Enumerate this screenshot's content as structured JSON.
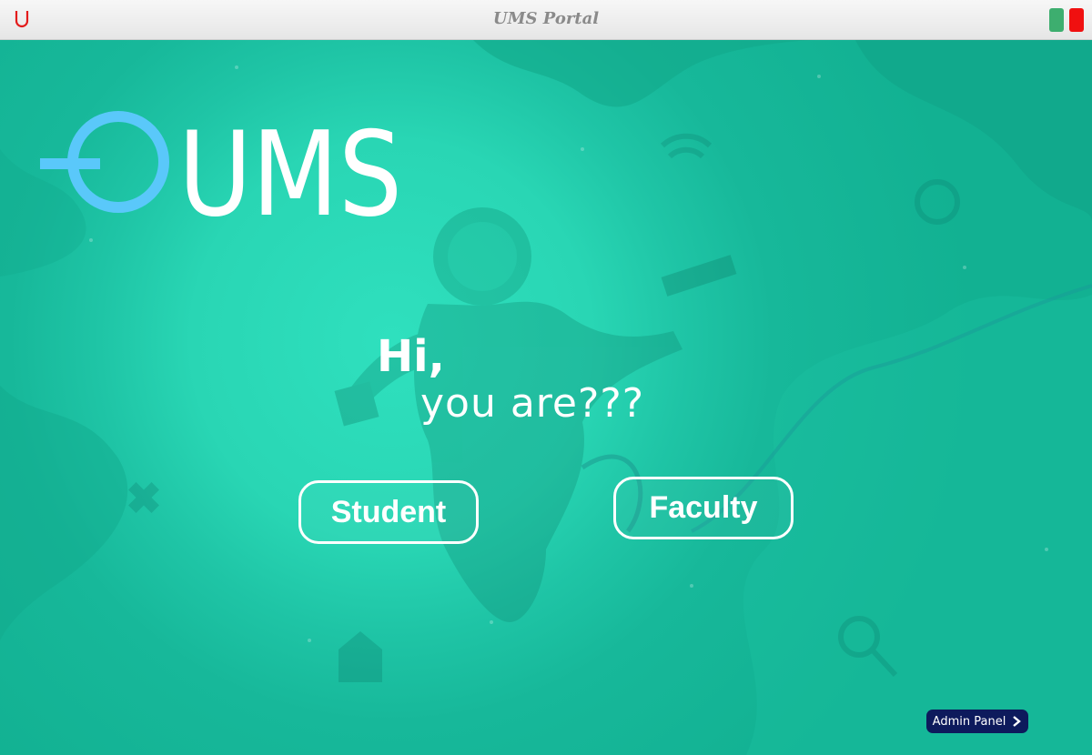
{
  "window": {
    "title": "UMS Portal",
    "app_icon": "U",
    "min_color": "#3dae6f",
    "close_color": "#f01010"
  },
  "logo": {
    "text": "UMS",
    "ring_color": "#5ac8fa"
  },
  "greeting": {
    "line1": "Hi,",
    "line2": "you are???"
  },
  "roles": [
    {
      "label": "Student"
    },
    {
      "label": "Faculty"
    }
  ],
  "admin": {
    "label": "Admin Panel",
    "icon": "chevron-right-icon",
    "color": "#0d1a5c"
  },
  "theme": {
    "background": "#17b89a",
    "glow": "#2fe0be"
  }
}
